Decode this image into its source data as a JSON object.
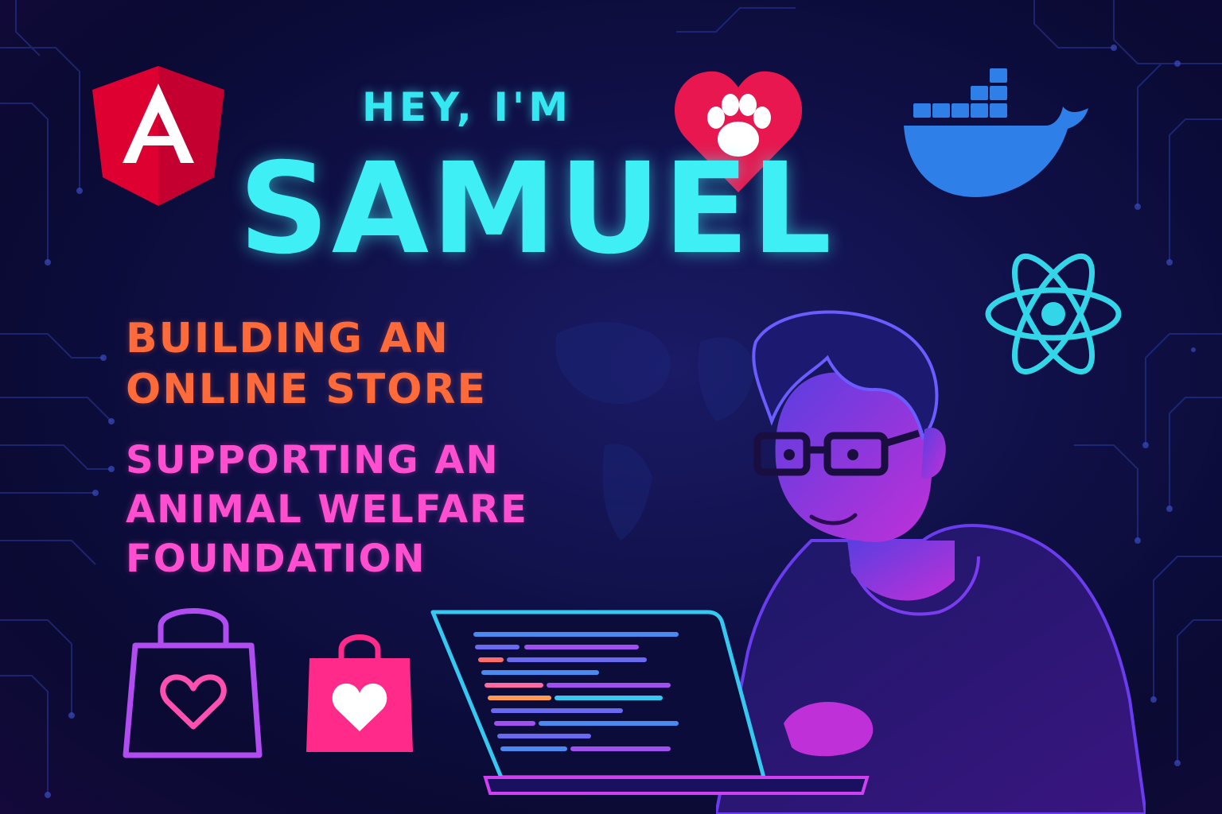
{
  "greeting": "HEY, I'M",
  "name": "SAMUEL",
  "tagline": {
    "line1": "BUILDING AN",
    "line2": "ONLINE STORE"
  },
  "mission": {
    "line1": "SUPPORTING AN",
    "line2": "ANIMAL WELFARE",
    "line3": "FOUNDATION"
  },
  "icons": [
    "angular-icon",
    "paw-heart-icon",
    "docker-icon",
    "react-icon",
    "shopping-bag-outline-icon",
    "shopping-bag-filled-icon",
    "laptop-icon",
    "developer-avatar"
  ],
  "colors": {
    "background": "#0f0f45",
    "name": "#3ef0f5",
    "greeting": "#34e7f0",
    "tagline": "#ff6a3a",
    "mission": "#ff4fd0",
    "angular": "#dd0031",
    "heart": "#e8174f",
    "docker": "#2f7fe8",
    "react": "#33d6e8"
  }
}
